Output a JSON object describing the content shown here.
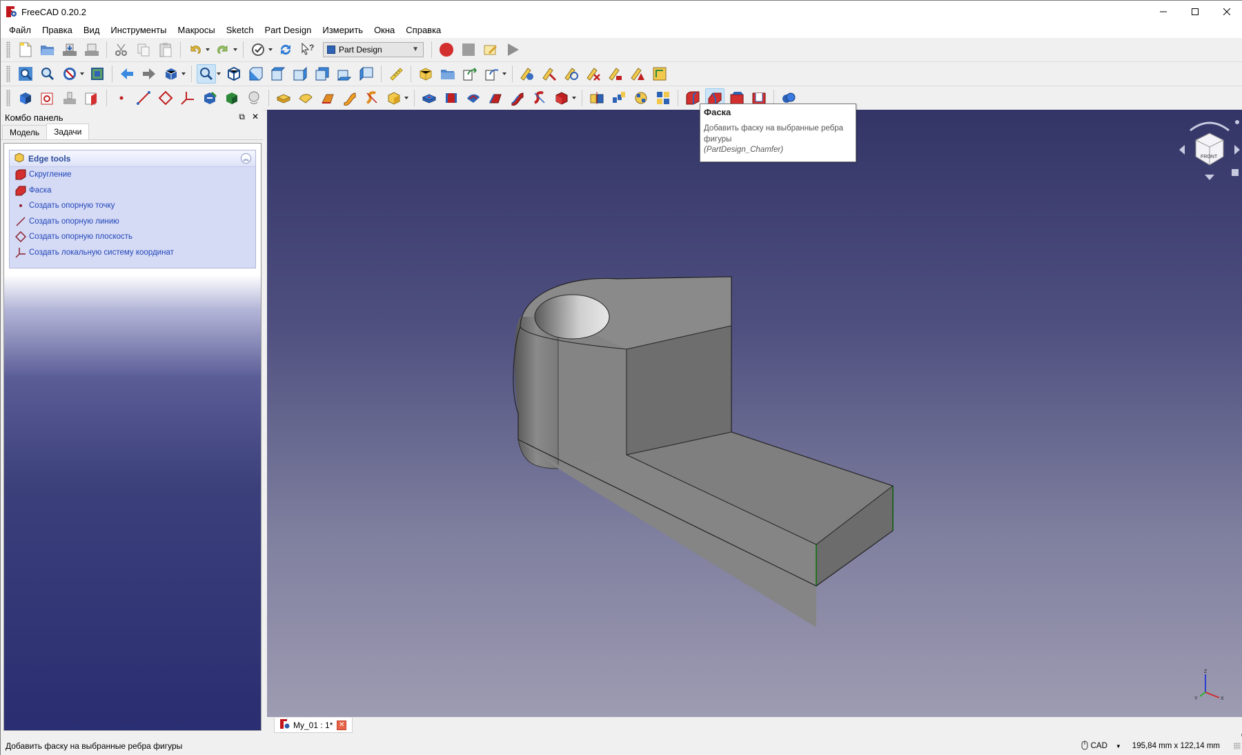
{
  "window": {
    "title": "FreeCAD 0.20.2"
  },
  "menu": {
    "items": [
      "Файл",
      "Правка",
      "Вид",
      "Инструменты",
      "Макросы",
      "Sketch",
      "Part Design",
      "Измерить",
      "Окна",
      "Справка"
    ]
  },
  "toolbar": {
    "workbench_selected": "Part Design"
  },
  "combo_panel": {
    "title": "Комбо панель",
    "tabs": [
      "Модель",
      "Задачи"
    ],
    "active_tab": "Задачи"
  },
  "task_panel": {
    "section_title": "Edge tools",
    "items": [
      {
        "label": "Скругление",
        "icon": "fillet-icon"
      },
      {
        "label": "Фаска",
        "icon": "chamfer-icon"
      },
      {
        "label": "Создать опорную точку",
        "icon": "datum-point-icon"
      },
      {
        "label": "Создать опорную линию",
        "icon": "datum-line-icon"
      },
      {
        "label": "Создать опорную плоскость",
        "icon": "datum-plane-icon"
      },
      {
        "label": "Создать локальную систему координат",
        "icon": "local-coordinate-system-icon"
      }
    ]
  },
  "tooltip": {
    "title": "Фаска",
    "description": "Добавить фаску на выбранные ребра фигуры",
    "command": "(PartDesign_Chamfer)"
  },
  "document_tab": {
    "label": "My_01 : 1*"
  },
  "navcube": {
    "face_label": "FRONT"
  },
  "statusbar": {
    "message": "Добавить фаску на выбранные ребра фигуры",
    "navigation_style": "CAD",
    "dimensions": "195,84 mm x 122,14 mm"
  },
  "axis_labels": {
    "x": "X",
    "y": "Y",
    "z": "Z"
  },
  "colors": {
    "accent_red": "#d32f2f",
    "selected_edge": "#22c422",
    "link_blue": "#2146b8"
  }
}
